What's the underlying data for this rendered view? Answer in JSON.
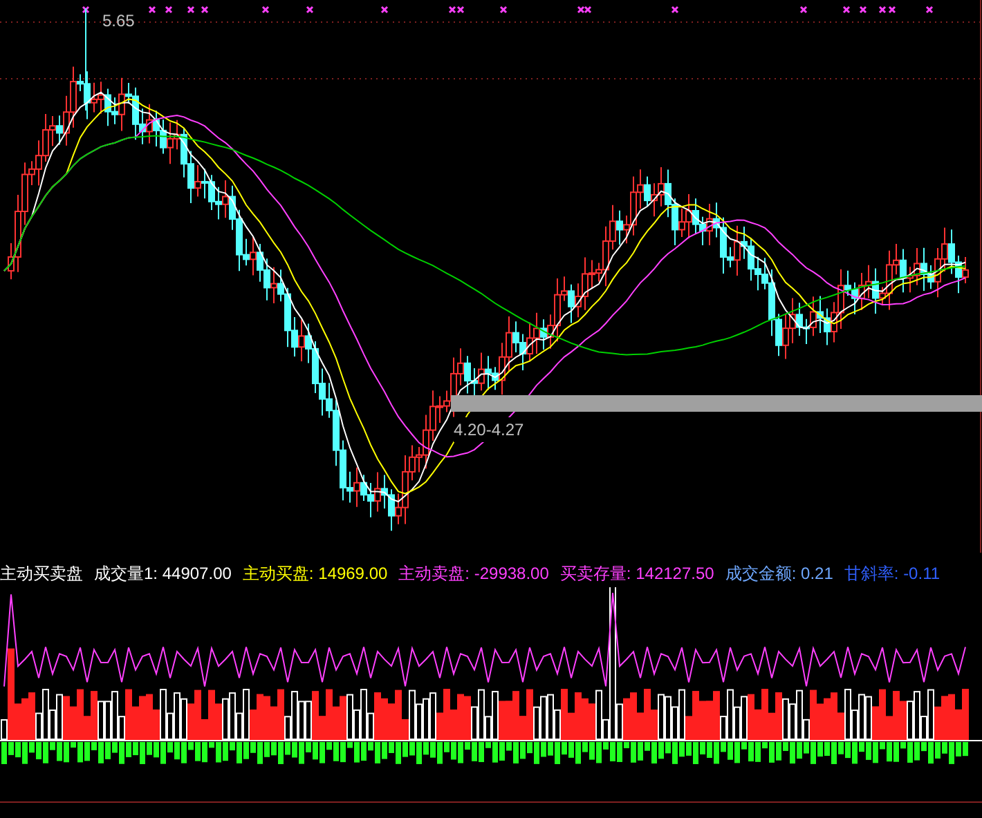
{
  "price_panel": {
    "high_label": "5.65",
    "range_label": "4.20-4.27"
  },
  "indicator": {
    "title": "主动买卖盘",
    "items": [
      {
        "label": "成交量1:",
        "value": "44907.00",
        "color": "#ffffff"
      },
      {
        "label": "主动买盘:",
        "value": "14969.00",
        "color": "#ffff00"
      },
      {
        "label": "主动卖盘:",
        "value": "-29938.00",
        "color": "#ff40ff"
      },
      {
        "label": "买卖存量:",
        "value": "142127.50",
        "color": "#ff40ff"
      },
      {
        "label": "成交金额:",
        "value": "0.21",
        "color": "#6fa8ff"
      },
      {
        "label": "甘斜率:",
        "value": "-0.11",
        "color": "#3060ff"
      }
    ]
  }
}
